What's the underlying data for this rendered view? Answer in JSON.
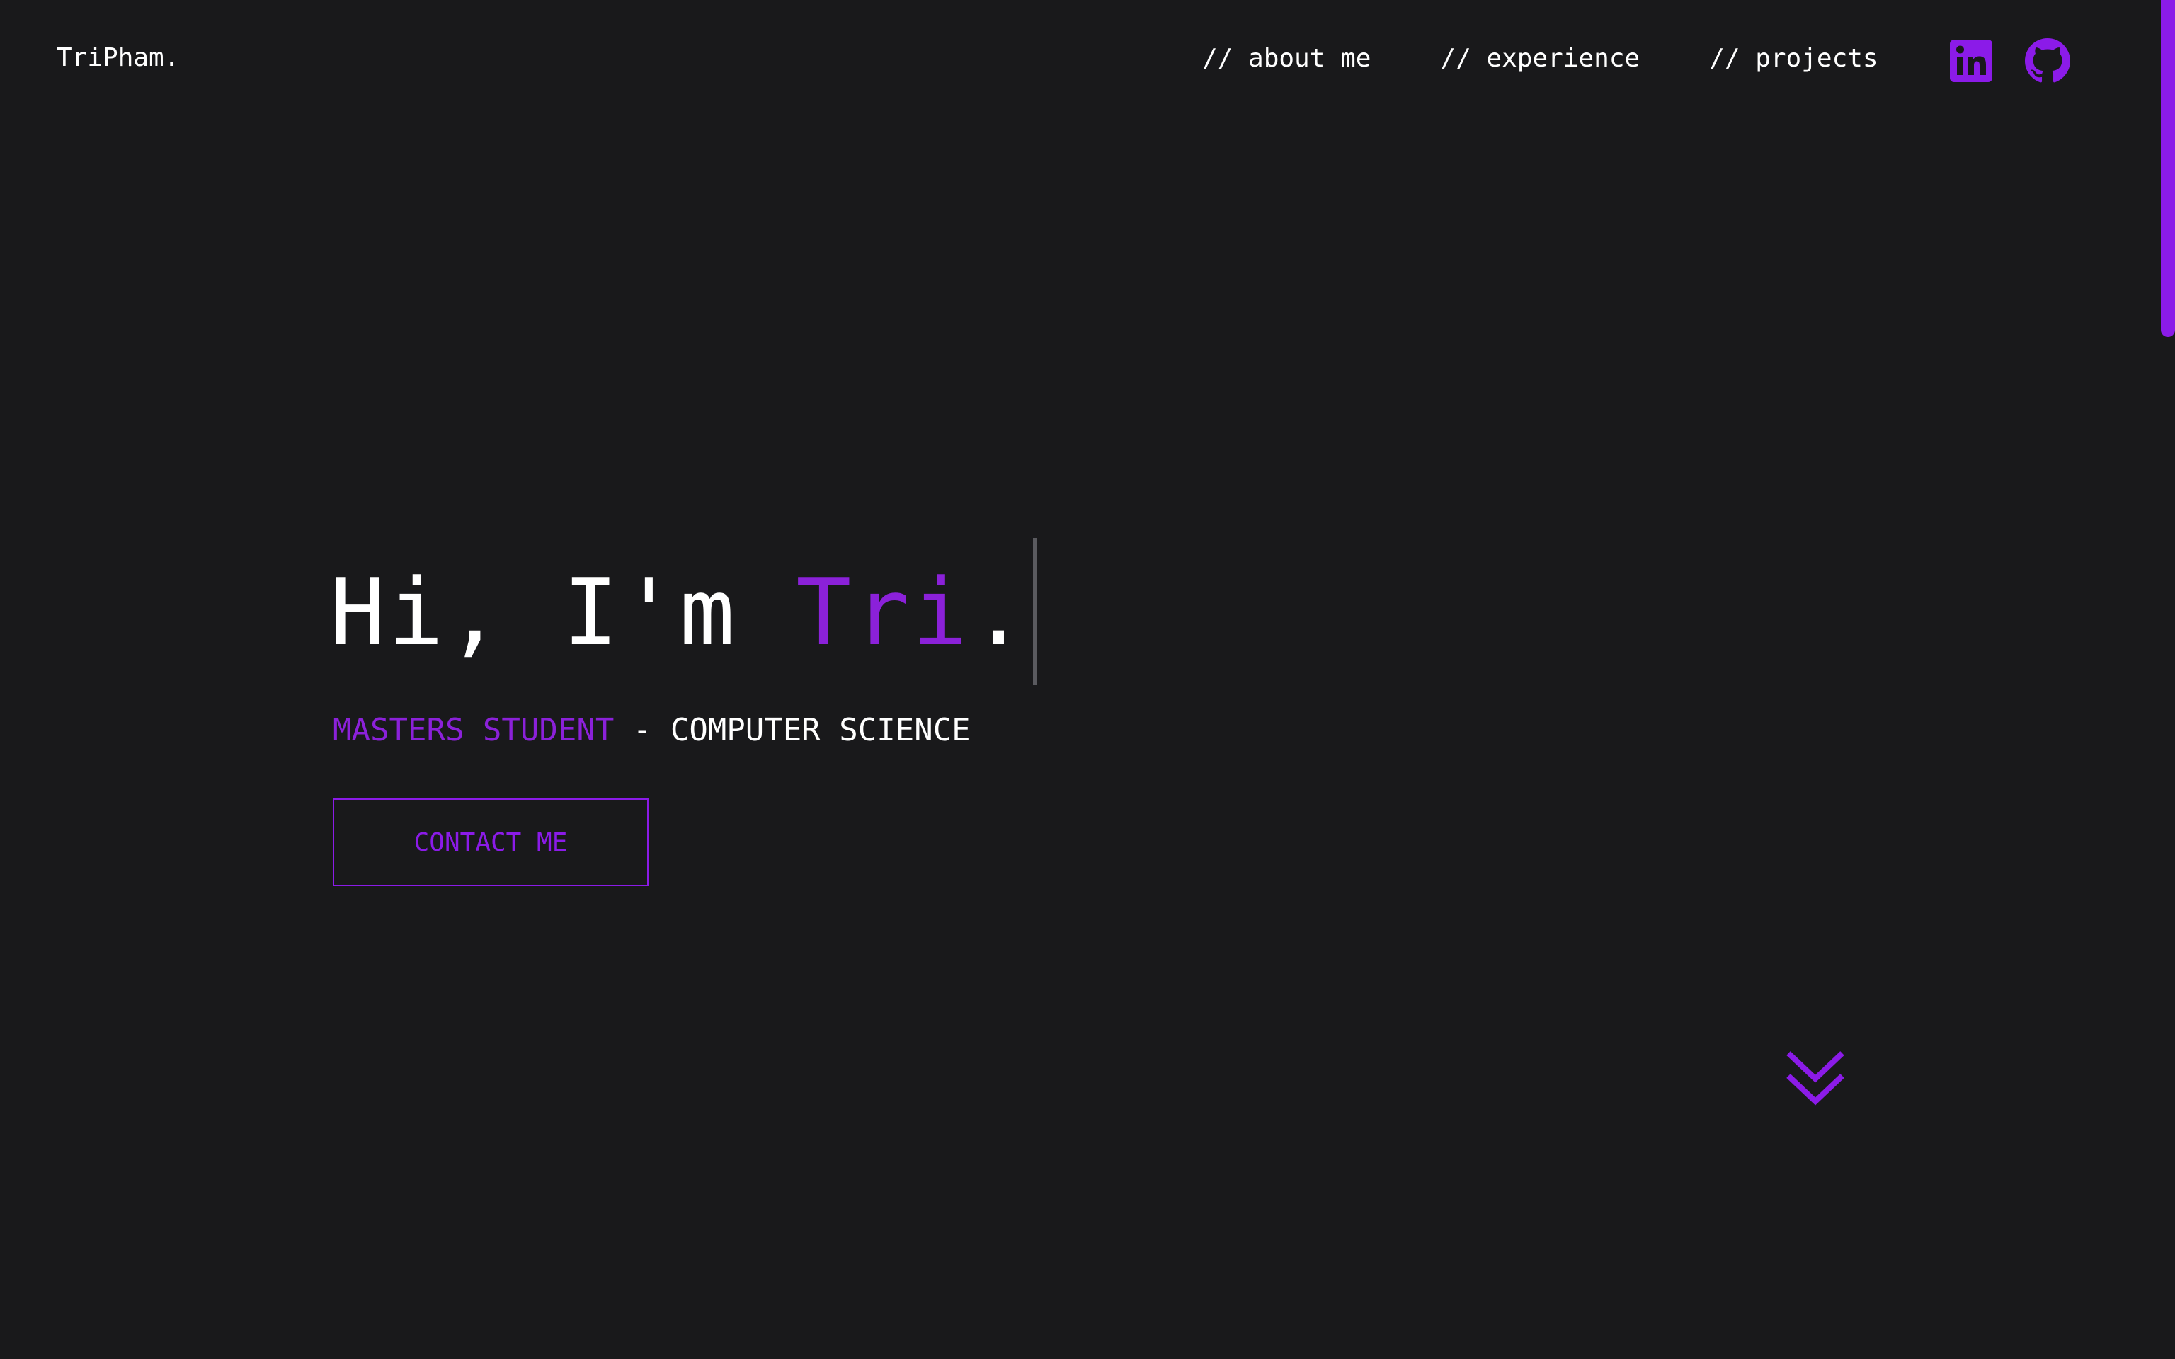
{
  "brand": {
    "logo_text": "TriPham.",
    "accent_color": "#8b1be8",
    "background_color": "#19191b"
  },
  "nav": {
    "links": [
      {
        "label": "// about me"
      },
      {
        "label": "// experience"
      },
      {
        "label": "// projects"
      }
    ],
    "social": [
      {
        "icon": "linkedin-icon"
      },
      {
        "icon": "github-icon"
      }
    ]
  },
  "hero": {
    "greeting": "Hi, I'm ",
    "name": "Tri",
    "punctuation": ".",
    "subtitle_accent": "MASTERS STUDENT",
    "subtitle_rest": " - COMPUTER SCIENCE",
    "contact_label": "CONTACT ME",
    "scroll_icon": "double-chevron-down-icon"
  }
}
